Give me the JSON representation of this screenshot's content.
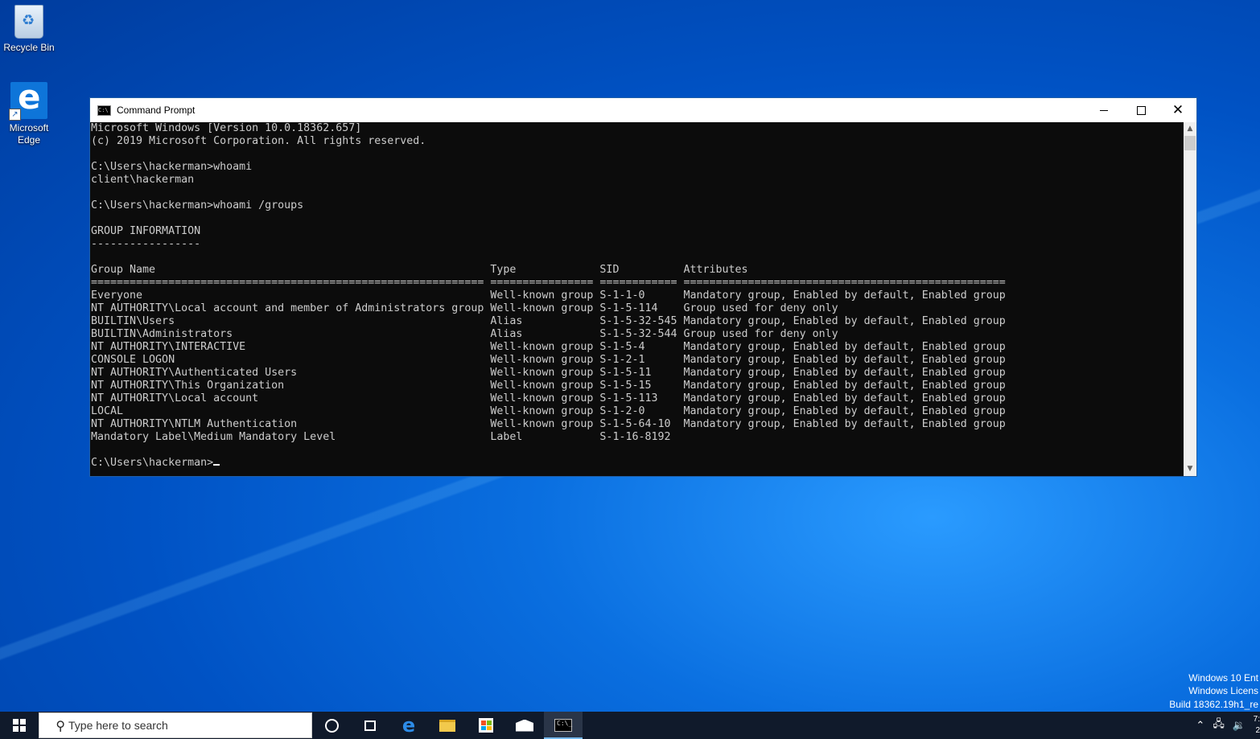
{
  "desktop": {
    "icons": [
      {
        "label": "Recycle Bin"
      },
      {
        "label": "Microsoft Edge"
      }
    ]
  },
  "window": {
    "title": "Command Prompt",
    "buttons": {
      "minimize": "minimize",
      "maximize": "maximize",
      "close": "close"
    }
  },
  "console": {
    "lines": [
      "Microsoft Windows [Version 10.0.18362.657]",
      "(c) 2019 Microsoft Corporation. All rights reserved.",
      "",
      "C:\\Users\\hackerman>whoami",
      "client\\hackerman",
      "",
      "C:\\Users\\hackerman>whoami /groups",
      "",
      "GROUP INFORMATION",
      "-----------------",
      "",
      "Group Name                                                    Type             SID          Attributes",
      "============================================================= ================ ============ ==================================================",
      "Everyone                                                      Well-known group S-1-1-0      Mandatory group, Enabled by default, Enabled group",
      "NT AUTHORITY\\Local account and member of Administrators group Well-known group S-1-5-114    Group used for deny only",
      "BUILTIN\\Users                                                 Alias            S-1-5-32-545 Mandatory group, Enabled by default, Enabled group",
      "BUILTIN\\Administrators                                        Alias            S-1-5-32-544 Group used for deny only",
      "NT AUTHORITY\\INTERACTIVE                                      Well-known group S-1-5-4      Mandatory group, Enabled by default, Enabled group",
      "CONSOLE LOGON                                                 Well-known group S-1-2-1      Mandatory group, Enabled by default, Enabled group",
      "NT AUTHORITY\\Authenticated Users                              Well-known group S-1-5-11     Mandatory group, Enabled by default, Enabled group",
      "NT AUTHORITY\\This Organization                                Well-known group S-1-5-15     Mandatory group, Enabled by default, Enabled group",
      "NT AUTHORITY\\Local account                                    Well-known group S-1-5-113    Mandatory group, Enabled by default, Enabled group",
      "LOCAL                                                         Well-known group S-1-2-0      Mandatory group, Enabled by default, Enabled group",
      "NT AUTHORITY\\NTLM Authentication                              Well-known group S-1-5-64-10  Mandatory group, Enabled by default, Enabled group",
      "Mandatory Label\\Medium Mandatory Level                        Label            S-1-16-8192",
      ""
    ],
    "prompt": "C:\\Users\\hackerman>"
  },
  "watermark": {
    "line1": "Windows 10 Ent",
    "line2": "Windows Licens",
    "line3": "Build 18362.19h1_re"
  },
  "taskbar": {
    "search_placeholder": "Type here to search",
    "clock_time": "7:",
    "clock_date": "2"
  },
  "colors": {
    "console_bg": "#0c0c0c",
    "console_fg": "#cccccc",
    "taskbar_bg": "#101a2b",
    "desktop_accent": "#0a6fe0"
  }
}
